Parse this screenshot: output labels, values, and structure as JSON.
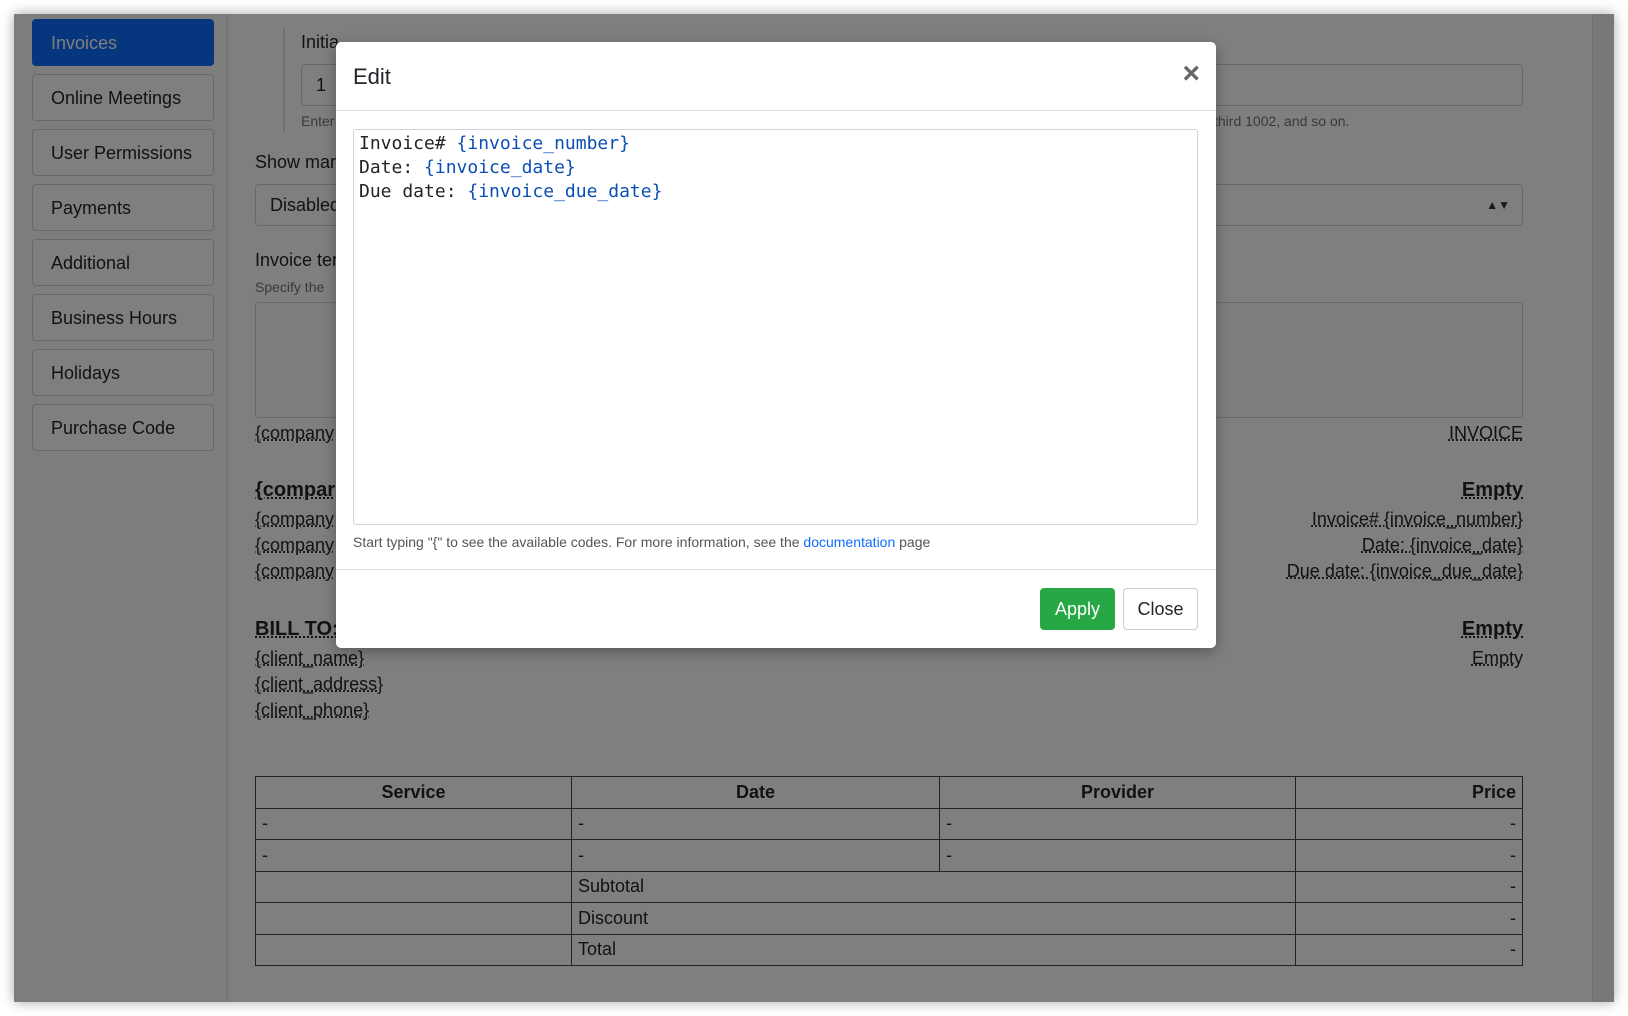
{
  "sidebar": {
    "items": [
      {
        "label": "Invoices"
      },
      {
        "label": "Online Meetings"
      },
      {
        "label": "User Permissions"
      },
      {
        "label": "Payments"
      },
      {
        "label": "Additional"
      },
      {
        "label": "Business Hours"
      },
      {
        "label": "Holidays"
      },
      {
        "label": "Purchase Code"
      }
    ]
  },
  "settings": {
    "initial_label": "Initia",
    "initial_value": "1",
    "initial_hint_start": "Enter",
    "initial_hint_end": "third 1002, and so on.",
    "show_label": "Show mar",
    "show_value": "Disabled",
    "template_label": "Invoice ter",
    "template_hint": "Specify the"
  },
  "template": {
    "company_top": "{company",
    "invoice_heading": "INVOICE",
    "company_bold": "{compar",
    "company_1": "{company",
    "company_2": "{company",
    "company_3": "{company",
    "empty_bold_1": "Empty",
    "invoice_number": "Invoice# {invoice_number}",
    "invoice_date": "Date: {invoice_date}",
    "invoice_due": "Due date: {invoice_due_date}",
    "bill_to": "BILL TO:",
    "client_name": "{client_name}",
    "client_address": "{client_address}",
    "client_phone": "{client_phone}",
    "empty_bold_2": "Empty",
    "empty_plain": "Empty"
  },
  "table": {
    "headers": [
      "Service",
      "Date",
      "Provider",
      "Price"
    ],
    "rows": [
      [
        "-",
        "-",
        "-",
        "-"
      ],
      [
        "-",
        "-",
        "-",
        "-"
      ]
    ],
    "summary": [
      {
        "label": "Subtotal",
        "value": "-"
      },
      {
        "label": "Discount",
        "value": "-"
      },
      {
        "label": "Total",
        "value": "-"
      }
    ]
  },
  "modal": {
    "title": "Edit",
    "close_symbol": "×",
    "lines": [
      {
        "prefix": "Invoice# ",
        "code": "{invoice_number}"
      },
      {
        "prefix": "Date: ",
        "code": "{invoice_date}"
      },
      {
        "prefix": "Due date: ",
        "code": "{invoice_due_date}"
      }
    ],
    "hint_before": "Start typing \"{\" to see the available codes. For more information, see the ",
    "hint_link": "documentation",
    "hint_after": " page",
    "apply_label": "Apply",
    "close_label": "Close"
  },
  "colors": {
    "primary": "#0d6efd",
    "apply": "#28a745",
    "code": "#0b4fb5"
  }
}
